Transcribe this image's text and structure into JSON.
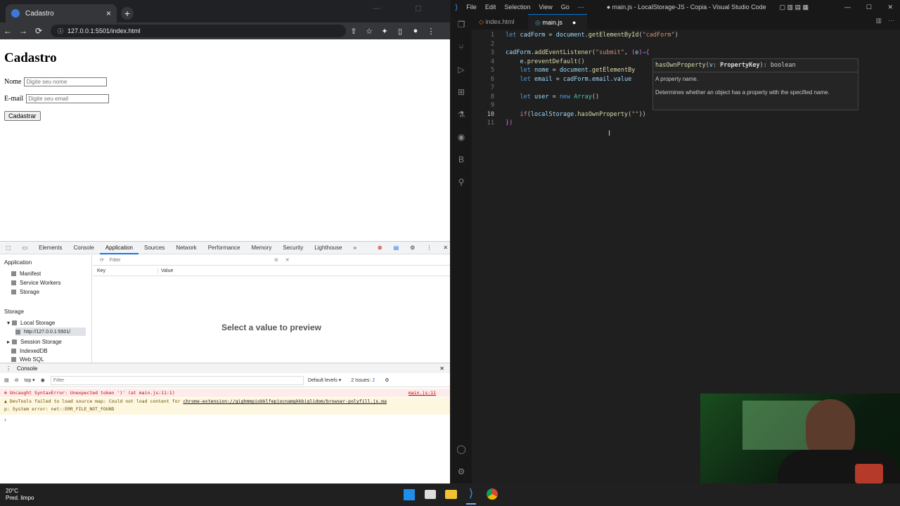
{
  "browser": {
    "tab_title": "Cadastro",
    "tab_close": "×",
    "new_tab": "+",
    "url": "127.0.0.1:5501/index.html",
    "back": "←",
    "forward": "→",
    "reload": "⟳"
  },
  "page": {
    "heading": "Cadastro",
    "name_label": "Nome",
    "name_placeholder": "Digite seu nome",
    "email_label": "E-mail",
    "email_placeholder": "Digite seu email",
    "submit_label": "Cadastrar"
  },
  "devtools": {
    "tabs": [
      "Elements",
      "Console",
      "Application",
      "Sources",
      "Network",
      "Performance",
      "Memory",
      "Security",
      "Lighthouse"
    ],
    "more_tabs": "»",
    "error_count": "1",
    "issue_count": "2",
    "sidebar": {
      "application_header": "Application",
      "application_items": [
        "Manifest",
        "Service Workers",
        "Storage"
      ],
      "storage_header": "Storage",
      "storage_items": [
        "Local Storage",
        "http://127.0.0.1:5501/",
        "Session Storage",
        "IndexedDB",
        "Web SQL"
      ]
    },
    "filter_placeholder": "Filter",
    "key_col": "Key",
    "value_col": "Value",
    "preview_text": "Select a value to preview",
    "drawer_title": "Console",
    "console_context": "top",
    "console_filter": "Filter",
    "levels": "Default levels",
    "issues": "2 Issues:",
    "issues_count": "2",
    "messages": {
      "error": "Uncaught SyntaxError: Unexpected token ')' (at main.js:11:1)",
      "error_src": "main.js:11",
      "warn_line1_a": "DevTools failed to load source map: Could not load content for ",
      "warn_link": "chrome-extension://gighmmpiobklfepjocnamgkkbiglidom/browser-polyfill.js.ma",
      "warn_line2": "p: System error: net::ERR_FILE_NOT_FOUND"
    }
  },
  "vscode": {
    "menu": [
      "File",
      "Edit",
      "Selection",
      "View",
      "Go",
      "···"
    ],
    "window_title": "● main.js - LocalStorage-JS - Copia - Visual Studio Code",
    "tabs": [
      "index.html",
      "main.js"
    ],
    "active_tab": "main.js",
    "line_numbers": [
      "1",
      "2",
      "3",
      "4",
      "5",
      "6",
      "7",
      "8",
      "9",
      "10",
      "11"
    ],
    "hover": {
      "signature_name": "hasOwnProperty",
      "signature_param": "v",
      "signature_type": "PropertyKey",
      "signature_ret": "boolean",
      "param_desc": "A property name.",
      "description": "Determines whether an object has a property with the specified name."
    }
  },
  "taskbar": {
    "temperature": "20°C",
    "weather": "Pred. limpo"
  },
  "colors": {
    "vscode_bg": "#1f1f1f",
    "accent_blue": "#007acc",
    "error_red": "#c00000"
  }
}
